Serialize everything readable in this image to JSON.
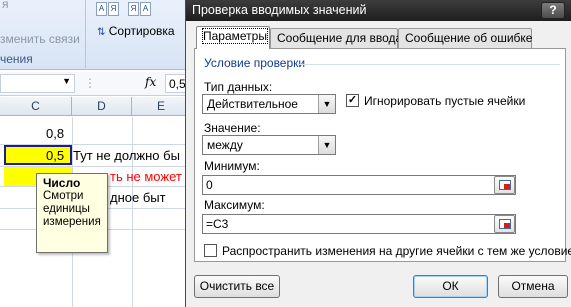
{
  "excel": {
    "ribbon": {
      "top_left_fragment": "я",
      "refresh_links": "зменить связи",
      "group_label": "чения",
      "sort_label": "Сортировка",
      "sort_icon_letters": [
        "А",
        "Я",
        "Я",
        "А"
      ]
    },
    "formula_bar": {
      "fx": "fx",
      "value": "0,5"
    },
    "columns": [
      "C",
      "D",
      "E"
    ],
    "cells": {
      "c1": "0,8",
      "c2": "0,5",
      "d2": "Тут не должно бы",
      "d3": "ть не может",
      "d4": "дное быт"
    },
    "tooltip": {
      "title": "Число",
      "body": "Смотри единицы измерения"
    },
    "colors": {
      "cell_highlight": "#ffff00",
      "error_text": "#ff0000"
    }
  },
  "dialog": {
    "title": "Проверка вводимых значений",
    "help": "?",
    "tabs": [
      "Параметры",
      "Сообщение для ввода",
      "Сообщение об ошибке"
    ],
    "active_tab": "Параметры",
    "group": "Условие проверки",
    "data_type": {
      "label": "Тип данных:",
      "value": "Действительное"
    },
    "ignore_blank": {
      "label": "Игнорировать пустые ячейки",
      "checked": true
    },
    "value": {
      "label": "Значение:",
      "value": "между"
    },
    "minimum": {
      "label": "Минимум:",
      "value": "0"
    },
    "maximum": {
      "label": "Максимум:",
      "value": "=C3"
    },
    "apply_all": {
      "label": "Распространить изменения на другие ячейки с тем же условием",
      "checked": false
    },
    "buttons": {
      "clear": "Очистить все",
      "ok": "ОК",
      "cancel": "Отмена"
    }
  }
}
